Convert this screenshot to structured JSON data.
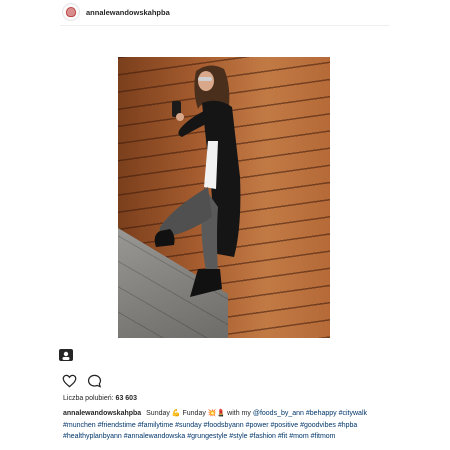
{
  "header": {
    "username": "annalewandowskahpba"
  },
  "post": {
    "likes_label": "Liczba polubień:",
    "likes_count": "63 603"
  },
  "caption": {
    "username": "annalewandowskahpba",
    "text_1": "Sunday 💪 Funday 💥💄 with my",
    "mention": "@foods_by_ann",
    "tags": [
      "#behappy",
      "#citywalk",
      "#munchen",
      "#friendstime",
      "#familytime",
      "#sunday",
      "#foodsbyann",
      "#power",
      "#positive",
      "#goodvibes",
      "#hpba",
      "#healthyplanbyann",
      "#annalewandowska",
      "#grungestyle",
      "#style",
      "#fashion",
      "#fit",
      "#mom",
      "#fitmom"
    ]
  },
  "icons": {
    "save": "bookmark-icon",
    "like": "heart-icon",
    "comment": "comment-icon"
  }
}
